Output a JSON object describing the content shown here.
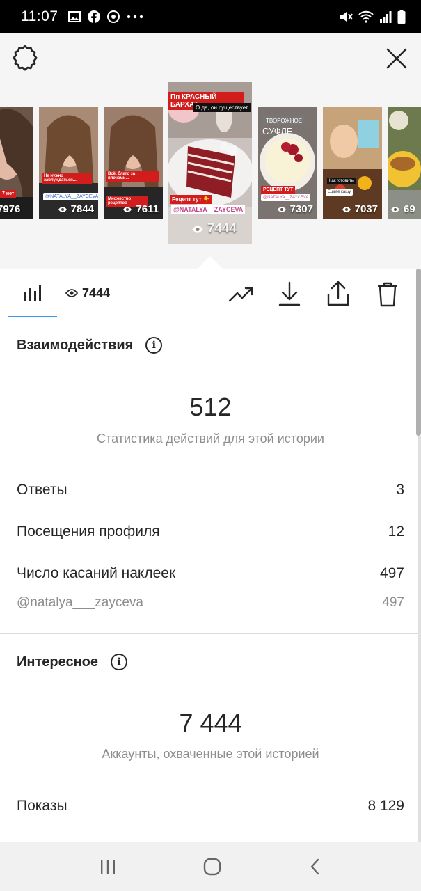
{
  "status_bar": {
    "time": "11:07",
    "left_icons": [
      "gallery-icon",
      "facebook-icon",
      "chrome-icon",
      "more-dots-icon"
    ],
    "right_icons": [
      "mute-icon",
      "wifi-icon",
      "signal-icon",
      "battery-icon"
    ]
  },
  "stories": [
    {
      "views": "7976"
    },
    {
      "views": "7844",
      "tag": "@NATALYA__ZAYCEVA"
    },
    {
      "views": "7611"
    },
    {
      "views": "7444",
      "title_banner": "Пп КРАСНЫЙ БАРХАТ",
      "subtitle_banner": "О да, он существует",
      "recipe_label": "Рецепт тут 👇",
      "mention": "@NATALYA__ZAYCEVA",
      "selected": true
    },
    {
      "views": "7307",
      "title_top": "ТВОРОЖНОЕ",
      "title_bottom": "СУФЛЕ",
      "recipe_label": "РЕЦЕПТ ТУТ",
      "mention": "@NATALYA__ZAYCEVA"
    },
    {
      "views": "7037"
    },
    {
      "views": "69"
    }
  ],
  "tabs": {
    "views_count": "7444"
  },
  "interactions": {
    "title": "Взаимодействия",
    "total": "512",
    "caption": "Статистика действий для этой истории",
    "rows": [
      {
        "label": "Ответы",
        "value": "3"
      },
      {
        "label": "Посещения профиля",
        "value": "12"
      },
      {
        "label": "Число касаний наклеек",
        "value": "497"
      }
    ],
    "sub_row": {
      "label": "@natalya___zayceva",
      "value": "497"
    }
  },
  "discovery": {
    "title": "Интересное",
    "total": "7 444",
    "caption": "Аккаунты, охваченные этой историей",
    "rows": [
      {
        "label": "Показы",
        "value": "8 129"
      }
    ]
  },
  "colors": {
    "accent": "#3897f0",
    "text": "#262626",
    "muted": "#8e8e8e",
    "sticker_red": "#d21d1d"
  }
}
